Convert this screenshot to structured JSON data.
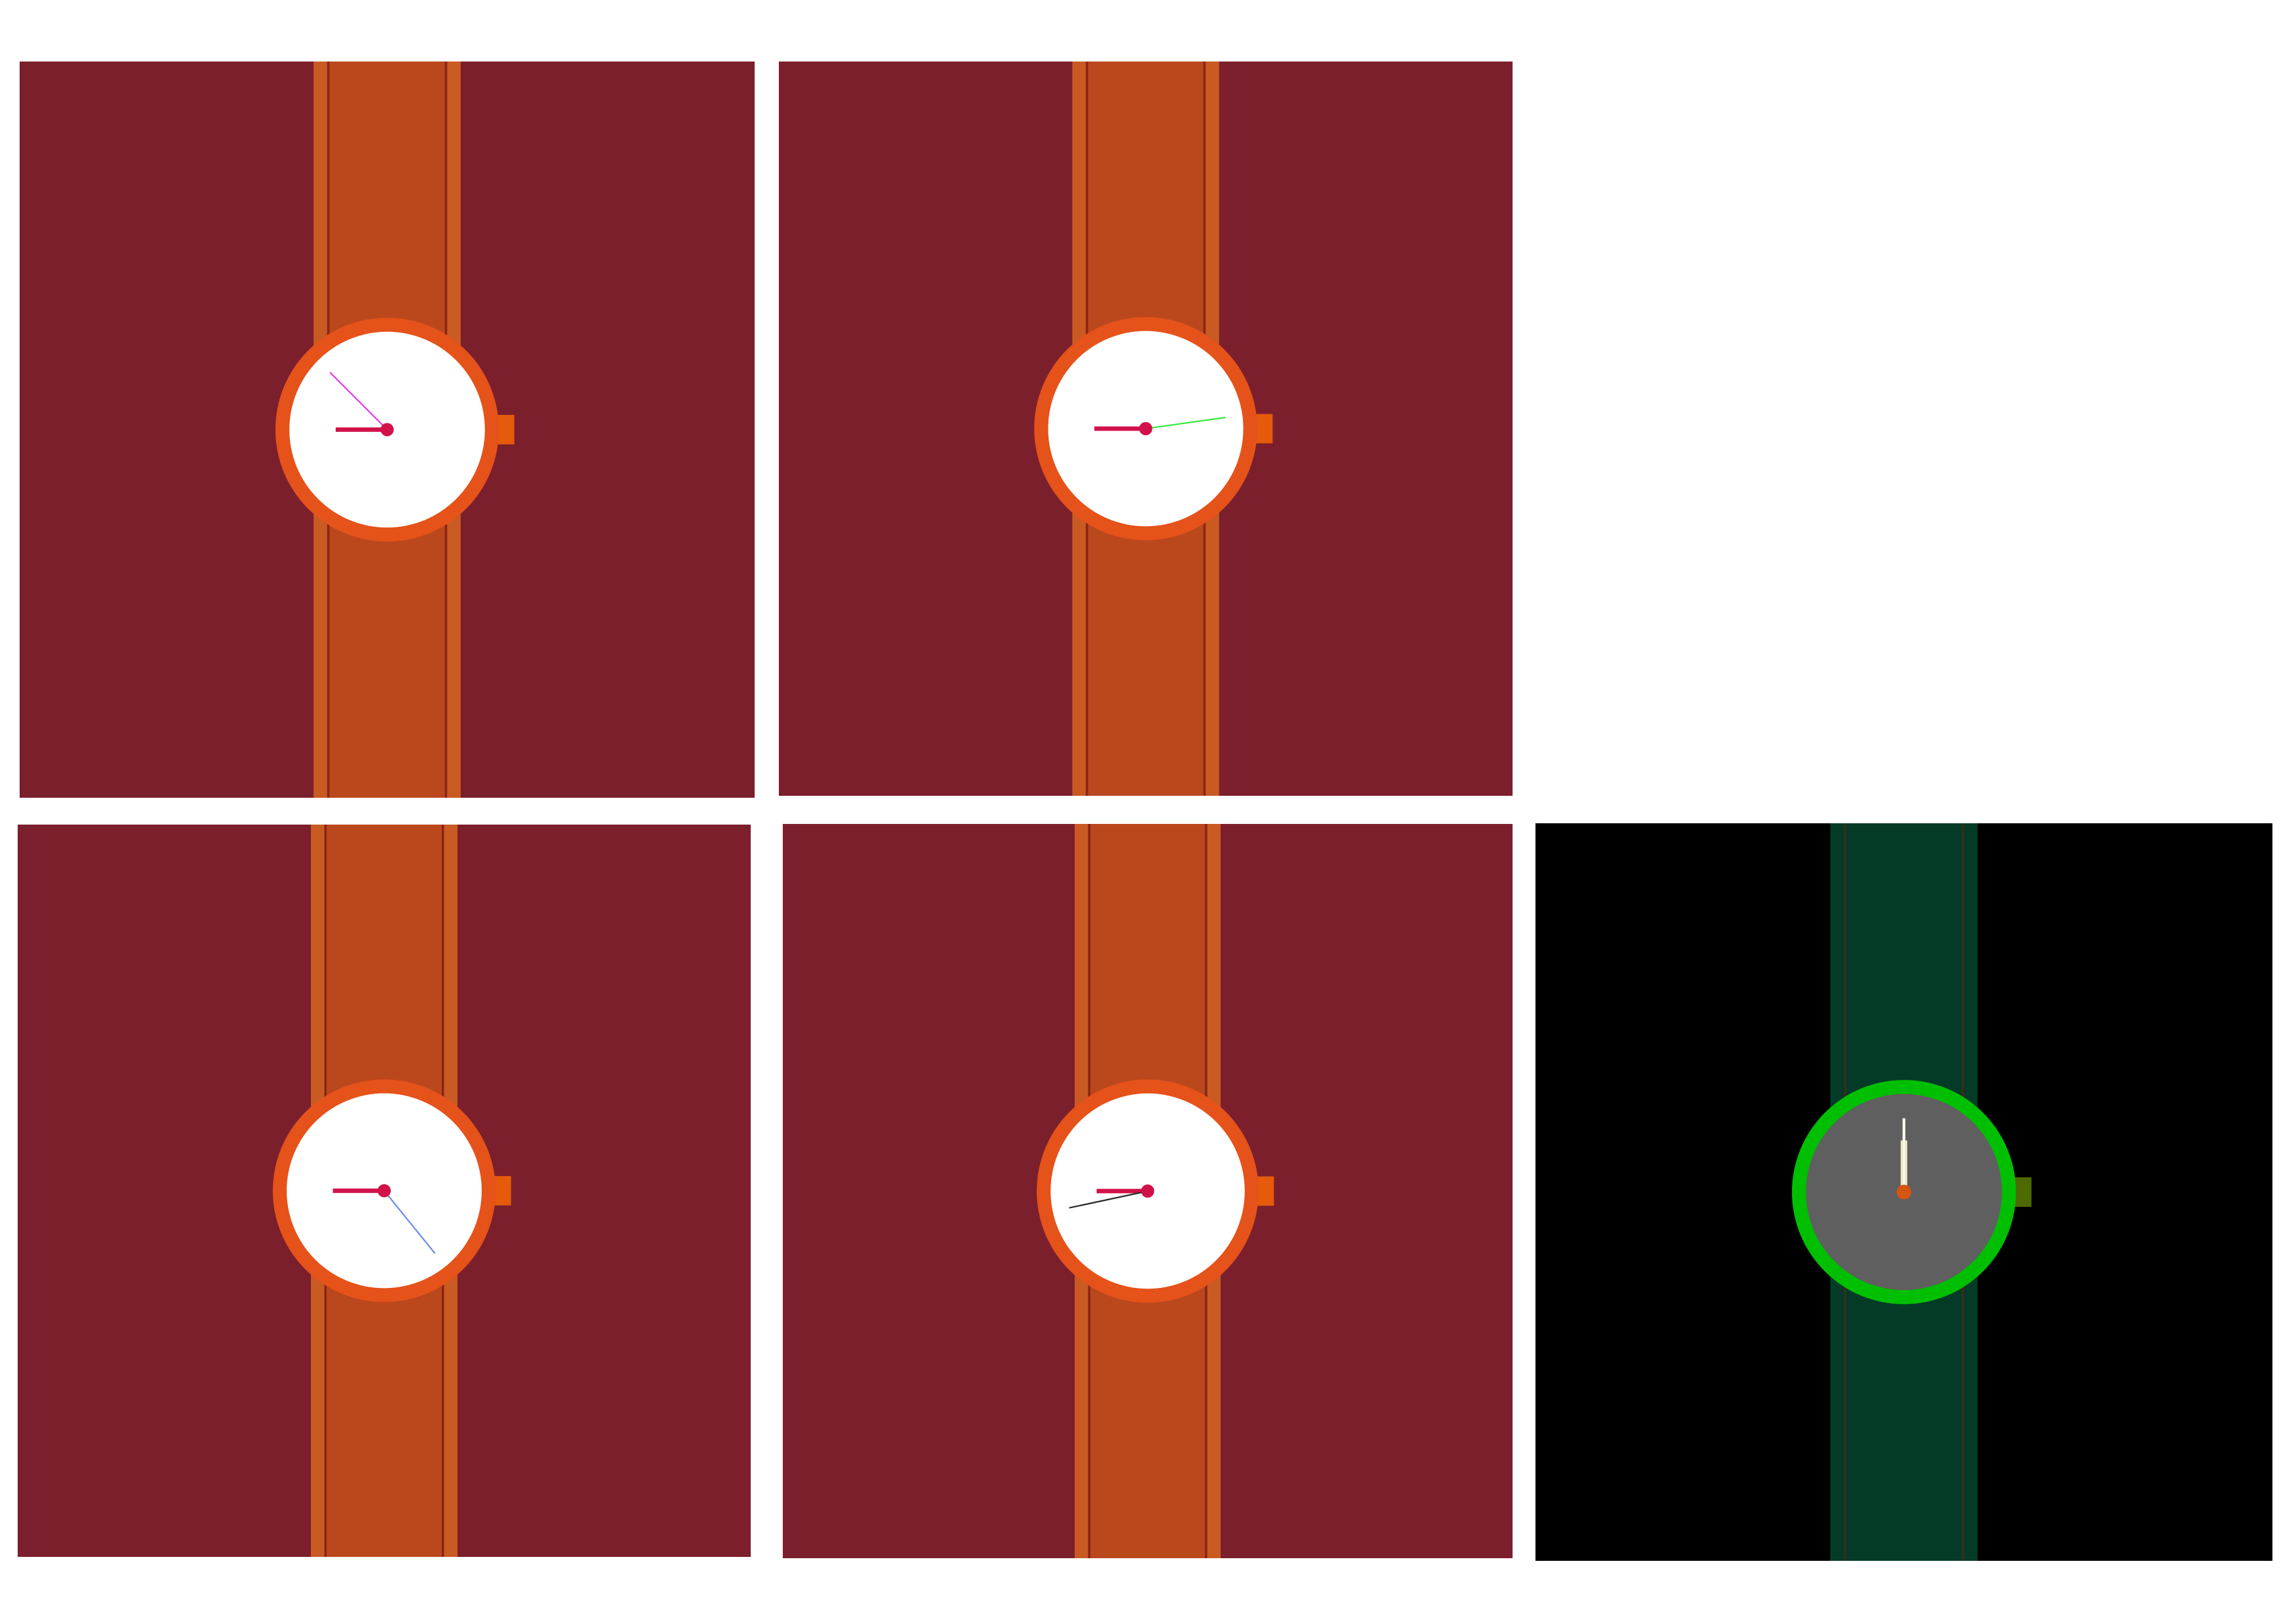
{
  "palette": {
    "page_bg": "#ffffff",
    "maroon_bg": "#7c1f2c",
    "orange_strap": "#bb481d",
    "orange_strap_edge": "#c95a22",
    "strap_line_dark": "#8a2415",
    "orange_case": "#e5521a",
    "orange_crown": "#e65a0b",
    "white_dial": "#ffffff",
    "crimson_hand": "#d1124a",
    "black_bg": "#000000",
    "green_strap": "#033b27",
    "green_strap_line": "#3d2a1c",
    "green_case": "#00bf00",
    "olive_crown": "#4d6a00",
    "gray_dial": "#5f5f5f",
    "cream_hand": "#e9e6c4",
    "orange_center": "#d45512"
  },
  "watches": [
    {
      "id": "top-left",
      "theme": "maroon",
      "hour_angle_deg": 270,
      "minute_angle_deg": null,
      "second_angle_deg": 315,
      "second_hand_color": "#e23ce8"
    },
    {
      "id": "top-middle",
      "theme": "maroon",
      "hour_angle_deg": 270,
      "minute_angle_deg": null,
      "second_angle_deg": 82,
      "second_hand_color": "#38e840"
    },
    {
      "id": "bottom-left",
      "theme": "maroon",
      "hour_angle_deg": 270,
      "minute_angle_deg": null,
      "second_angle_deg": 141,
      "second_hand_color": "#6f8ae8"
    },
    {
      "id": "bottom-middle",
      "theme": "maroon",
      "hour_angle_deg": 270,
      "minute_angle_deg": null,
      "second_angle_deg": 258,
      "second_hand_color": "#2a2a2a"
    },
    {
      "id": "bottom-right",
      "theme": "dark-green",
      "hour_angle_deg": 0,
      "minute_angle_deg": 0,
      "second_angle_deg": 0,
      "second_hand_color": "#ffffff"
    }
  ]
}
